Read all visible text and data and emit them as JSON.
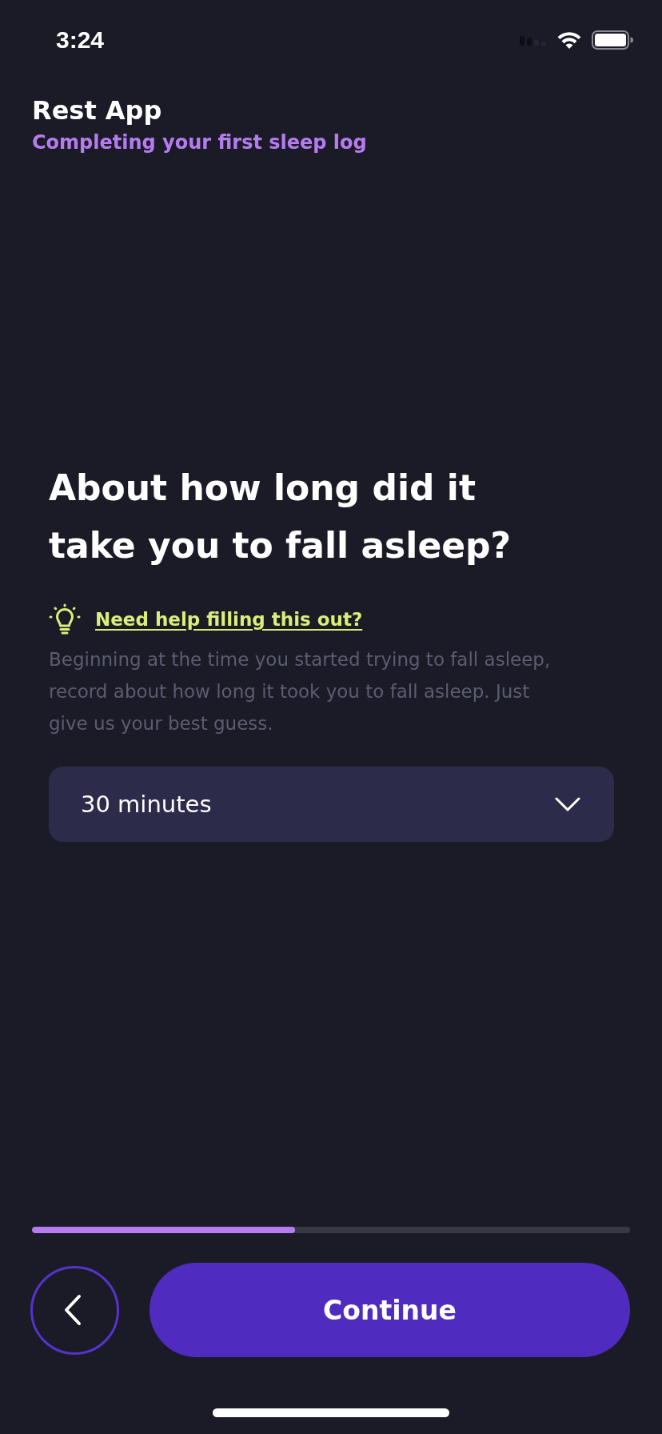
{
  "status_bar": {
    "time": "3:24"
  },
  "header": {
    "title": "Rest App",
    "subtitle": "Completing your first sleep log"
  },
  "question": {
    "title": "About how long did it take you to fall asleep?",
    "help_link": "Need help filling this out?",
    "description": "Beginning at the time you started trying to fall asleep, record about how long it took you to fall asleep. Just give us your best guess."
  },
  "answer_select": {
    "value": "30 minutes"
  },
  "progress": {
    "level": 0.44
  },
  "actions": {
    "continue_label": "Continue"
  }
}
